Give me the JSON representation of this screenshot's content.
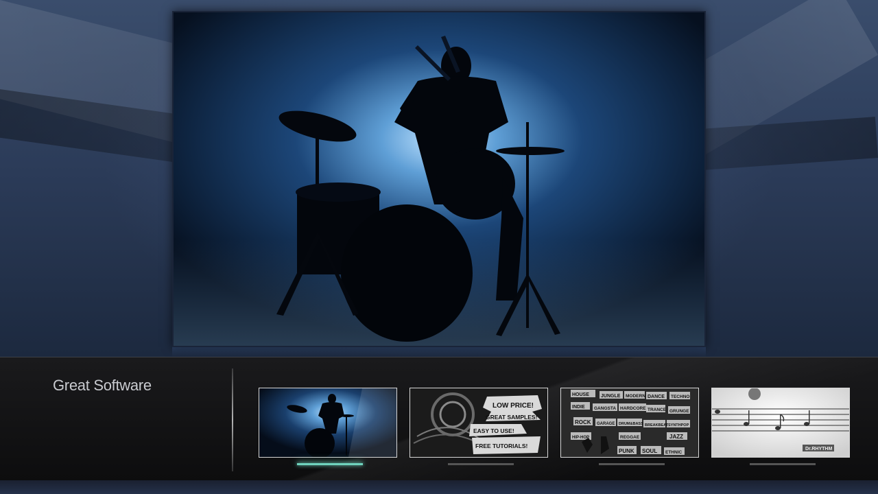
{
  "bottom_bar": {
    "title": "Great Software"
  },
  "thumbnails": [
    {
      "name": "drummer"
    },
    {
      "name": "promo",
      "lines": [
        "LOW PRICE!",
        "GREAT SAMPLES!",
        "EASY TO USE!",
        "FREE TUTORIALS!"
      ]
    },
    {
      "name": "genres",
      "tags": [
        "HOUSE",
        "JUNGLE",
        "MODERN",
        "DANCE",
        "TECHNO",
        "INDIE",
        "GANGSTA",
        "HARDCORE",
        "TRANCE",
        "GRUNGE",
        "ROCK",
        "GARAGE",
        "DRUM&BASS",
        "BREAKBEAT",
        "SYNTHPOP",
        "HIP-HOP",
        "REGGAE",
        "JAZZ",
        "PUNK",
        "SOUL",
        "ETHNIC"
      ]
    },
    {
      "name": "notes",
      "logo": "Dr.RHYTHM"
    }
  ],
  "active_thumbnail": 0,
  "colors": {
    "accent": "#6fd3bd",
    "spotlight": "#a9d4ff"
  }
}
